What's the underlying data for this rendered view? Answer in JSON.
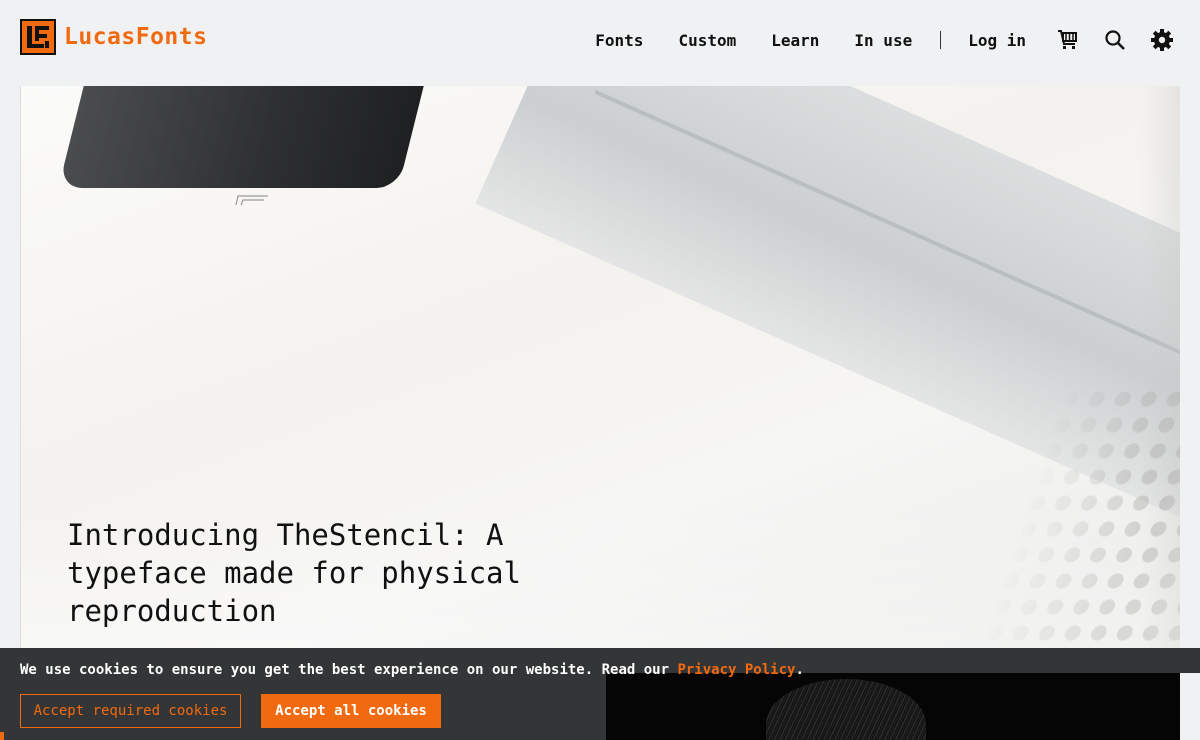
{
  "brand": {
    "name": "LucasFonts",
    "accent_color": "#f26a10"
  },
  "nav": {
    "items": [
      {
        "label": "Fonts"
      },
      {
        "label": "Custom"
      },
      {
        "label": "Learn"
      },
      {
        "label": "In use"
      }
    ],
    "login_label": "Log in",
    "icons": [
      "cart-icon",
      "search-icon",
      "gear-icon"
    ]
  },
  "hero": {
    "title": "Introducing TheStencil: A typeface made for physical reproduction"
  },
  "cookie_banner": {
    "text": "We use cookies to ensure you get the best experience on our website. Read our ",
    "link_label": "Privacy Policy",
    "text_end": ".",
    "accept_required_label": "Accept required cookies",
    "accept_all_label": "Accept all cookies",
    "background_color": "#333536"
  }
}
